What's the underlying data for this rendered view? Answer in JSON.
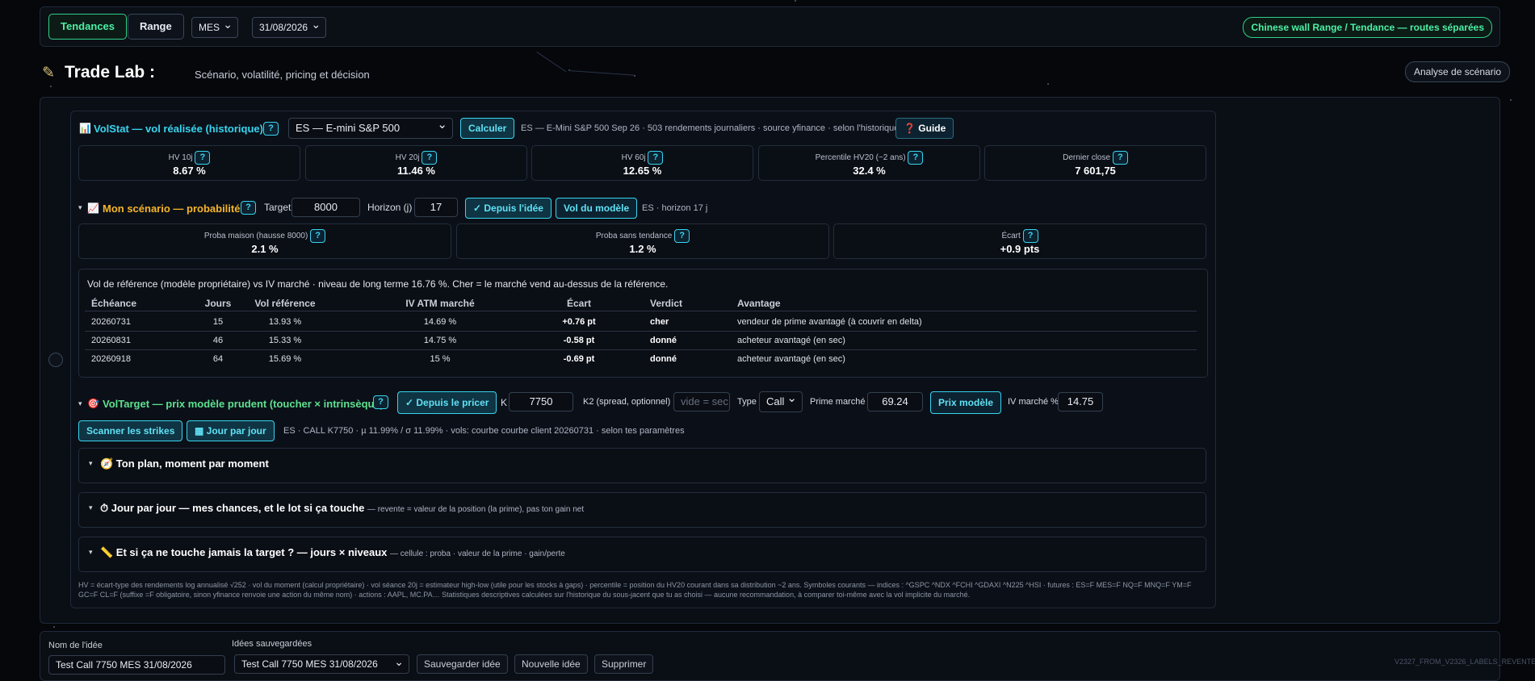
{
  "topbar": {
    "tab_tendances": "Tendances",
    "tab_range": "Range",
    "symbol_select": "MES",
    "date_select": "31/08/2026",
    "chinese_wall": "Chinese wall Range / Tendance — routes séparées"
  },
  "header": {
    "title": "Trade Lab :",
    "subtitle": "Scénario, volatilité, pricing et décision",
    "scenario_button": "Analyse de scénario"
  },
  "volstat": {
    "heading": "VolStat — vol réalisée (historique)",
    "help": "?",
    "instrument": "ES — E-mini S&P 500",
    "calc_button": "Calculer",
    "info": "ES — E-Mini S&P 500 Sep 26 · 503 rendements journaliers · source yfinance · selon l'historique",
    "guide_button": "❓ Guide",
    "stats": [
      {
        "label": "HV 10j",
        "value": "8.67 %"
      },
      {
        "label": "HV 20j",
        "value": "11.46 %"
      },
      {
        "label": "HV 60j",
        "value": "12.65 %"
      },
      {
        "label": "Percentile HV20 (~2 ans)",
        "value": "32.4 %"
      },
      {
        "label": "Dernier close",
        "value": "7 601,75"
      }
    ]
  },
  "scenario": {
    "heading": "Mon scénario — probabilités",
    "target_label": "Target",
    "target_value": "8000",
    "horizon_label": "Horizon (j)",
    "horizon_value": "17",
    "since_idea_button": "✓ Depuis l'idée",
    "model_vol_button": "Vol du modèle",
    "info": "ES · horizon 17 j",
    "stats": [
      {
        "label": "Proba maison (hausse 8000)",
        "value": "2.1 %"
      },
      {
        "label": "Proba sans tendance",
        "value": "1.2 %"
      },
      {
        "label": "Écart",
        "value": "+0.9 pts"
      }
    ]
  },
  "vol_table": {
    "intro": "Vol de référence (modèle propriétaire) vs IV marché · niveau de long terme 16.76 %. Cher = le marché vend au-dessus de la référence.",
    "headers": [
      "Échéance",
      "Jours",
      "Vol référence",
      "IV ATM marché",
      "Écart",
      "Verdict",
      "Avantage"
    ],
    "rows": [
      [
        "20260731",
        "15",
        "13.93 %",
        "14.69 %",
        "+0.76 pt",
        "cher",
        "vendeur de prime avantagé (à couvrir en delta)"
      ],
      [
        "20260831",
        "46",
        "15.33 %",
        "14.75 %",
        "-0.58 pt",
        "donné",
        "acheteur avantagé (en sec)"
      ],
      [
        "20260918",
        "64",
        "15.69 %",
        "15 %",
        "-0.69 pt",
        "donné",
        "acheteur avantagé (en sec)"
      ]
    ]
  },
  "voltarget": {
    "heading": "VolTarget — prix modèle prudent (toucher × intrinsèque)",
    "since_pricer_button": "✓ Depuis le pricer",
    "k_label": "K",
    "k_value": "7750",
    "k2_label": "K2 (spread, optionnel)",
    "k2_placeholder": "vide = sec",
    "type_label": "Type",
    "type_value": "Call",
    "market_premium_label": "Prime marché",
    "market_premium_value": "69.24",
    "model_price_button": "Prix modèle",
    "iv_label": "IV marché %",
    "iv_value": "14.75",
    "scan_button": "Scanner les strikes",
    "day_button": "Jour par jour",
    "info": "ES · CALL K7750 · µ 11.99% / σ 11.99% · vols: courbe courbe client 20260731 · selon tes paramètres"
  },
  "folds": {
    "plan_title": "🧭 Ton plan, moment par moment",
    "day_title": "⏱ Jour par jour — mes chances, et le lot si ça touche",
    "day_sub": "— revente = valeur de la position (la prime), pas ton gain net",
    "never_title": "📏 Et si ça ne touche jamais la target ? — jours × niveaux",
    "never_sub": "— cellule : proba · valeur de la prime · gain/perte"
  },
  "footnote": "HV = écart-type des rendements log annualisé √252 · vol du moment (calcul propriétaire) · vol séance 20j = estimateur high-low (utile pour les stocks à gaps) · percentile = position du HV20 courant dans sa distribution ~2 ans. Symboles courants — indices : ^GSPC ^NDX ^FCHI ^GDAXI ^N225 ^HSI · futures : ES=F MES=F NQ=F MNQ=F YM=F GC=F CL=F (suffixe =F obligatoire, sinon yfinance renvoie une action du même nom) · actions : AAPL, MC.PA… Statistiques descriptives calculées sur l'historique du sous-jacent que tu as choisi — aucune recommandation, à comparer toi-même avec la vol implicite du marché.",
  "bottom": {
    "idea_name_label": "Nom de l'idée",
    "idea_name_value": "Test Call 7750 MES 31/08/2026",
    "saved_label": "Idées sauvegardées",
    "saved_value": "Test Call 7750 MES 31/08/2026",
    "save_button": "Sauvegarder idée",
    "new_button": "Nouvelle idée",
    "delete_button": "Supprimer"
  },
  "watermark": "V2327_FROM_V2326_LABELS_REVENTE",
  "colors": {
    "accent_green": "#4cf0a4",
    "accent_cyan": "#38d4ef",
    "accent_orange": "#f5b52a",
    "background": "#05070b"
  }
}
